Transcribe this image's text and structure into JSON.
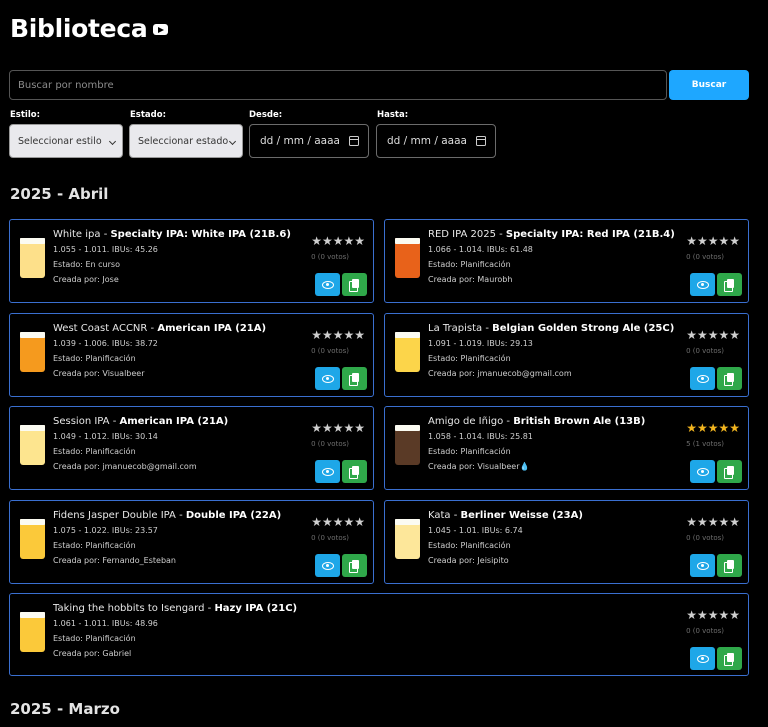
{
  "page": {
    "title": "Biblioteca"
  },
  "search": {
    "placeholder": "Buscar por nombre",
    "button_label": "Buscar"
  },
  "filters": {
    "estilo_label": "Estilo:",
    "estilo_value": "Seleccionar estilo",
    "estado_label": "Estado:",
    "estado_value": "Seleccionar estado",
    "desde_label": "Desde:",
    "desde_value": "dd / mm / aaaa",
    "hasta_label": "Hasta:",
    "hasta_value": "dd / mm / aaaa"
  },
  "sections": [
    {
      "title": "2025 - Abril",
      "recipes": [
        {
          "name": "White ipa - ",
          "style": "Specialty IPA: White IPA (21B.6)",
          "stats": "1.055 - 1.011. IBUs: 45.26",
          "status": "Estado: En curso",
          "author": "Creada por: Jose",
          "stars": "★★★★★",
          "votes": "0 (0 votos)",
          "rated": false,
          "glass_color": "#fde08a"
        },
        {
          "name": "RED IPA 2025 - ",
          "style": "Specialty IPA: Red IPA (21B.4)",
          "stats": "1.066 - 1.014. IBUs: 61.48",
          "status": "Estado: Planificación",
          "author": "Creada por: Maurobh",
          "stars": "★★★★★",
          "votes": "0 (0 votos)",
          "rated": false,
          "glass_color": "#e8621a"
        },
        {
          "name": "West Coast ACCNR - ",
          "style": "American IPA (21A)",
          "stats": "1.039 - 1.006. IBUs: 38.72",
          "status": "Estado: Planificación",
          "author": "Creada por: Visualbeer",
          "stars": "★★★★★",
          "votes": "0 (0 votos)",
          "rated": false,
          "glass_color": "#f59a1e"
        },
        {
          "name": "La Trapista - ",
          "style": "Belgian Golden Strong Ale (25C)",
          "stats": "1.091 - 1.019. IBUs: 29.13",
          "status": "Estado: Planificación",
          "author": "Creada por: jmanuecob@gmail.com",
          "stars": "★★★★★",
          "votes": "0 (0 votos)",
          "rated": false,
          "glass_color": "#fcd54a"
        },
        {
          "name": "Session IPA - ",
          "style": "American IPA (21A)",
          "stats": "1.049 - 1.012. IBUs: 30.14",
          "status": "Estado: Planificación",
          "author": "Creada por: jmanuecob@gmail.com",
          "stars": "★★★★★",
          "votes": "0 (0 votos)",
          "rated": false,
          "glass_color": "#fde58f"
        },
        {
          "name": "Amigo de Iñigo - ",
          "style": "British Brown Ale (13B)",
          "stats": "1.058 - 1.014. IBUs: 25.81",
          "status": "Estado: Planificación",
          "author": "Creada por: Visualbeer💧",
          "stars": "★★★★★",
          "votes": "5 (1 votos)",
          "rated": true,
          "glass_color": "#5a3a26"
        },
        {
          "name": "Fidens Jasper Double IPA - ",
          "style": "Double IPA (22A)",
          "stats": "1.075 - 1.022. IBUs: 23.57",
          "status": "Estado: Planificación",
          "author": "Creada por: Fernando_Esteban",
          "stars": "★★★★★",
          "votes": "0 (0 votos)",
          "rated": false,
          "glass_color": "#fbc93a"
        },
        {
          "name": "Kata - ",
          "style": "Berliner Weisse (23A)",
          "stats": "1.045 - 1.01. IBUs: 6.74",
          "status": "Estado: Planificación",
          "author": "Creada por: Jeisipito",
          "stars": "★★★★★",
          "votes": "0 (0 votos)",
          "rated": false,
          "glass_color": "#fde79a"
        },
        {
          "name": "Taking the hobbits to Isengard - ",
          "style": "Hazy IPA (21C)",
          "stats": "1.061 - 1.011. IBUs: 48.96",
          "status": "Estado: Planificación",
          "author": "Creada por: Gabriel",
          "stars": "★★★★★",
          "votes": "0 (0 votos)",
          "rated": false,
          "glass_color": "#fbc93a"
        }
      ]
    },
    {
      "title": "2025 - Marzo",
      "recipes": []
    }
  ]
}
